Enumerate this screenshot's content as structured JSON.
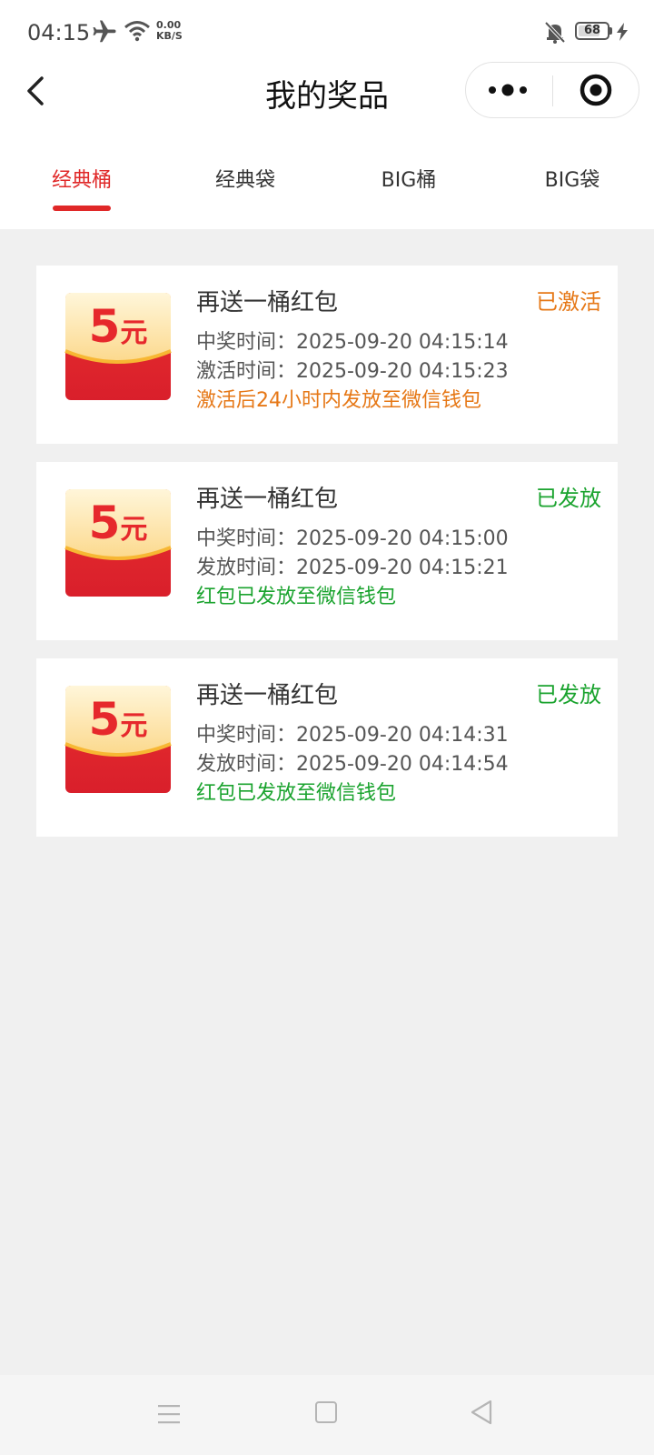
{
  "status_bar": {
    "time": "04:15",
    "net_speed_value": "0.00",
    "net_speed_unit": "KB/S",
    "battery": "68"
  },
  "nav": {
    "title": "我的奖品"
  },
  "tabs": [
    {
      "label": "经典桶",
      "active": true
    },
    {
      "label": "经典袋",
      "active": false
    },
    {
      "label": "BIG桶",
      "active": false
    },
    {
      "label": "BIG袋",
      "active": false
    }
  ],
  "colors": {
    "accent_red": "#e02828",
    "status_orange": "#e67817",
    "status_green": "#1aa32e"
  },
  "prizes": [
    {
      "badge_amount": "5",
      "badge_unit": "元",
      "title": "再送一桶红包",
      "status": "已激活",
      "line1": "中奖时间：2025-09-20 04:15:14",
      "line2": "激活时间：2025-09-20 04:15:23",
      "note": "激活后24小时内发放至微信钱包"
    },
    {
      "badge_amount": "5",
      "badge_unit": "元",
      "title": "再送一桶红包",
      "status": "已发放",
      "line1": "中奖时间：2025-09-20 04:15:00",
      "line2": "发放时间：2025-09-20 04:15:21",
      "note": "红包已发放至微信钱包"
    },
    {
      "badge_amount": "5",
      "badge_unit": "元",
      "title": "再送一桶红包",
      "status": "已发放",
      "line1": "中奖时间：2025-09-20 04:14:31",
      "line2": "发放时间：2025-09-20 04:14:54",
      "note": "红包已发放至微信钱包"
    }
  ],
  "icons": {
    "airplane": "airplane-icon",
    "wifi": "wifi-icon",
    "mute": "mute-icon",
    "charging": "charging-icon",
    "back": "back-arrow-icon",
    "more": "more-dots-icon",
    "target": "target-icon",
    "system_menu": "menu-icon",
    "system_home": "home-square-icon",
    "system_back": "back-triangle-icon"
  }
}
